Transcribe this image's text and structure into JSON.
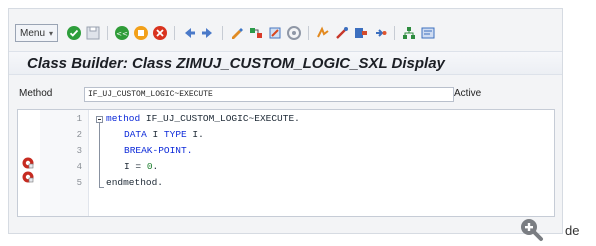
{
  "toolbar": {
    "menu_label": "Menu",
    "icons": [
      "check-icon",
      "save-icon",
      "back-icon",
      "exit-icon",
      "cancel-icon",
      "previous-icon",
      "next-icon",
      "edit-icon",
      "other-object-icon",
      "display-change-icon",
      "active-inactive-icon",
      "where-used-icon",
      "check-syntax-icon",
      "activate-icon",
      "test-icon",
      "hierarchy-icon",
      "help-icon"
    ]
  },
  "title": "Class Builder: Class ZIMUJ_CUSTOM_LOGIC_SXL Display",
  "method": {
    "label": "Method",
    "value": "IF_UJ_CUSTOM_LOGIC~EXECUTE",
    "status": "Active"
  },
  "editor": {
    "lines": [
      {
        "n": "1",
        "kw1": "method",
        "text": " IF_UJ_CUSTOM_LOGIC~EXECUTE.",
        "breakpoint": false
      },
      {
        "n": "2",
        "kw1": "DATA",
        "text": " I ",
        "kw2": "TYPE",
        "text2": " I.",
        "breakpoint": false
      },
      {
        "n": "3",
        "kw1": "BREAK-POINT.",
        "breakpoint": true
      },
      {
        "n": "4",
        "pre": "I = ",
        "num": "0",
        "post": ".",
        "breakpoint": true
      },
      {
        "n": "5",
        "kw1": "endmethod.",
        "breakpoint": false
      }
    ]
  },
  "overlay": {
    "zoom_icon": "magnifier-plus-icon",
    "trailing_text": "de"
  }
}
